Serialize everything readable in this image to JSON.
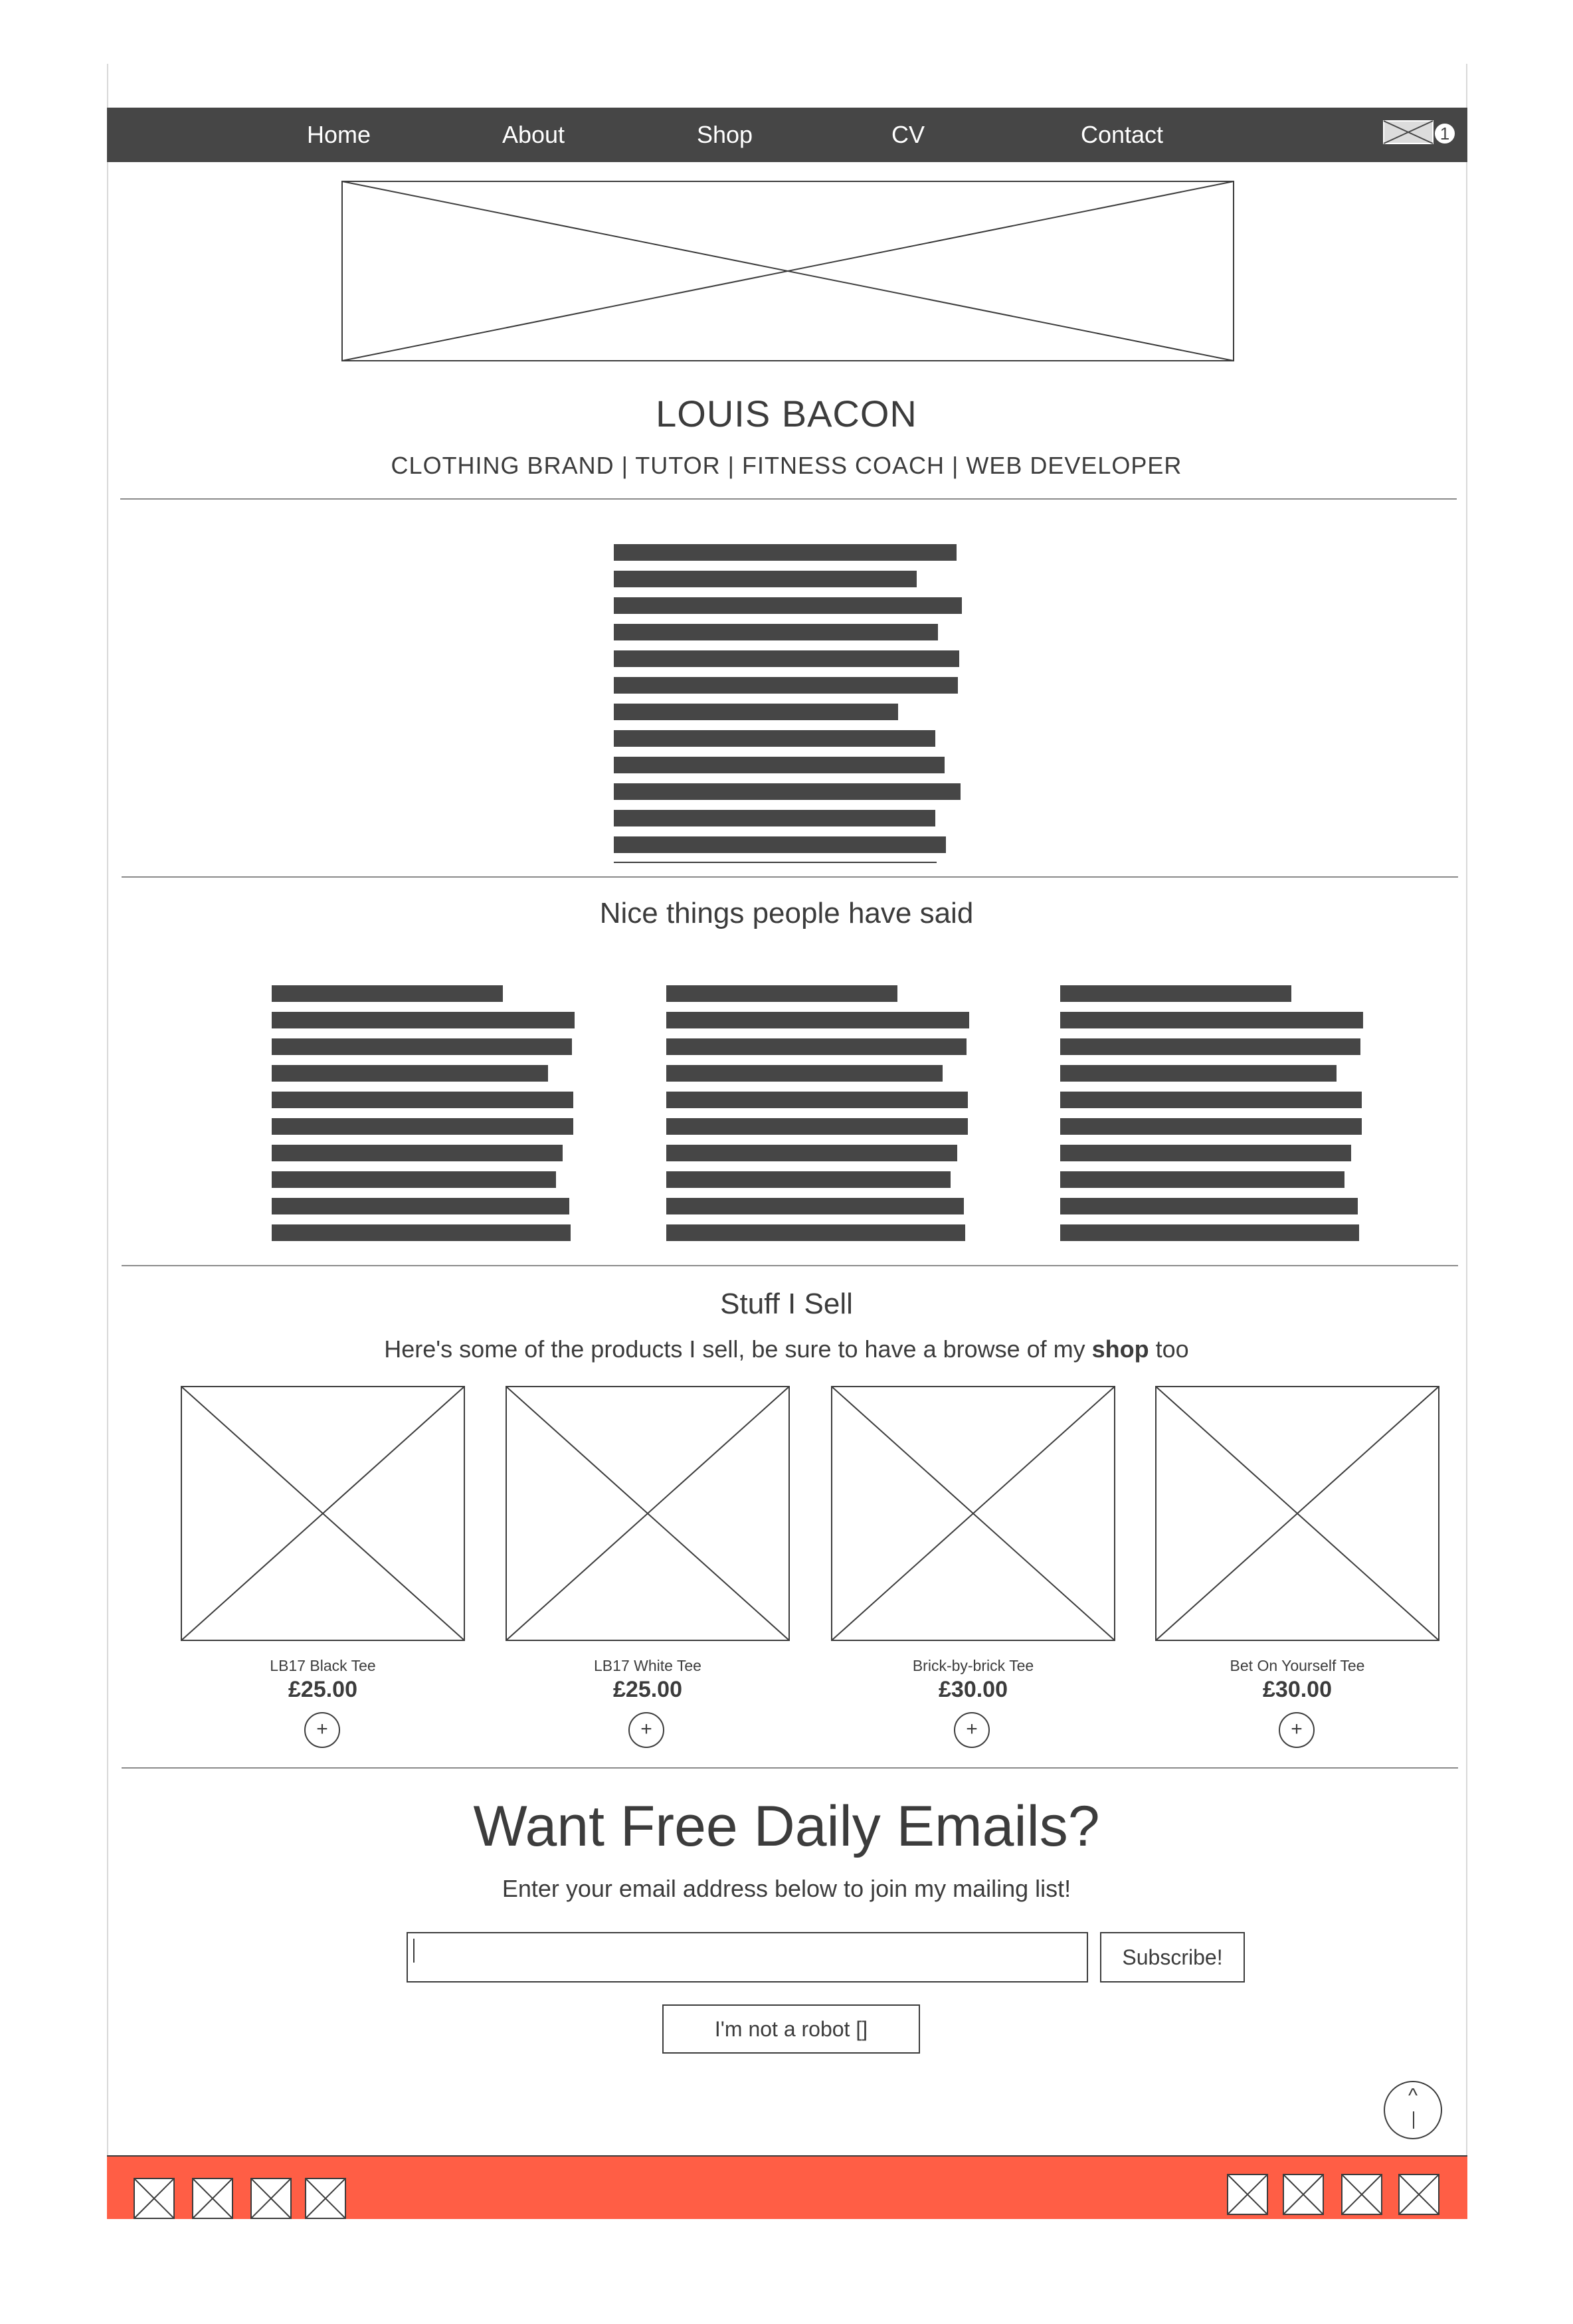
{
  "nav": {
    "items": [
      "Home",
      "About",
      "Shop",
      "CV",
      "Contact"
    ],
    "mail_icon": "envelope-icon",
    "mail_count": "1"
  },
  "hero": {
    "title": "LOUIS BACON",
    "subtitle": "CLOTHING BRAND | TUTOR | FITNESS COACH | WEB DEVELOPER"
  },
  "testimonials": {
    "title": "Nice things people have said"
  },
  "shop": {
    "title": "Stuff I Sell",
    "subtitle_before": "Here's some of the products I sell, be sure to have a browse of my ",
    "subtitle_link": "shop",
    "subtitle_after": " too",
    "products": [
      {
        "name": "LB17 Black Tee",
        "price": "£25.00",
        "add_label": "+"
      },
      {
        "name": "LB17 White Tee",
        "price": "£25.00",
        "add_label": "+"
      },
      {
        "name": "Brick-by-brick Tee",
        "price": "£30.00",
        "add_label": "+"
      },
      {
        "name": "Bet On Yourself Tee",
        "price": "£30.00",
        "add_label": "+"
      }
    ]
  },
  "newsletter": {
    "title": "Want Free Daily Emails?",
    "subtitle": "Enter your email address below to join my mailing list!",
    "email_value": "",
    "subscribe_label": "Subscribe!",
    "robot_label": "I'm not a robot []"
  },
  "back_to_top": {
    "caret": "^"
  },
  "colors": {
    "nav_bg": "#464646",
    "footer_bg": "#ff5e45",
    "chrome": "#dcdcdc",
    "text": "#3c3c3c"
  }
}
